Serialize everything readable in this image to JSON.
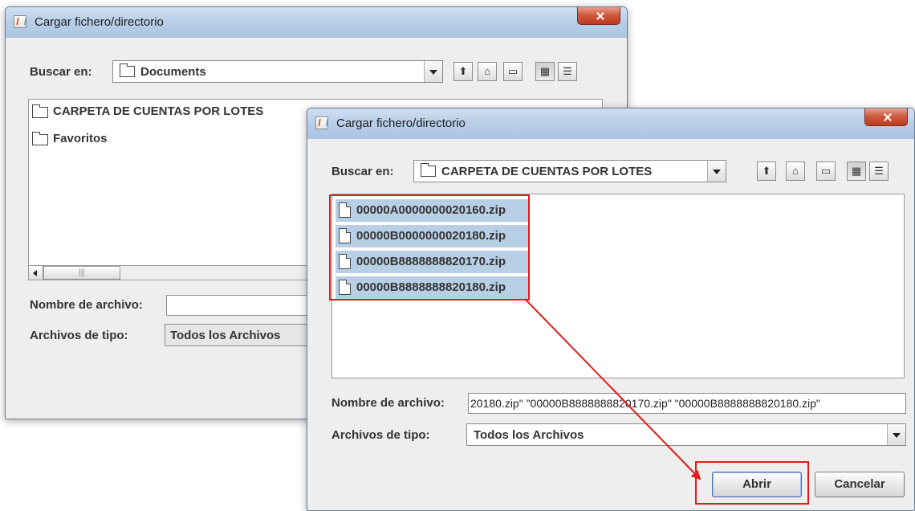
{
  "back_dialog": {
    "title": "Cargar fichero/directorio",
    "look_in_label": "Buscar en:",
    "look_in_value": "Documents",
    "folders": [
      "CARPETA DE CUENTAS POR LOTES",
      "Favoritos"
    ],
    "filename_label": "Nombre de archivo:",
    "filename_value": "",
    "filetype_label": "Archivos de tipo:",
    "filetype_value": "Todos los Archivos"
  },
  "front_dialog": {
    "title": "Cargar fichero/directorio",
    "look_in_label": "Buscar en:",
    "look_in_value": "CARPETA DE CUENTAS POR LOTES",
    "files": [
      "00000A0000000020160.zip",
      "00000B0000000020180.zip",
      "00000B8888888820170.zip",
      "00000B8888888820180.zip"
    ],
    "filename_label": "Nombre de archivo:",
    "filename_value": "20180.zip\" \"00000B8888888820170.zip\" \"00000B8888888820180.zip\"",
    "filetype_label": "Archivos de tipo:",
    "filetype_value": "Todos los Archivos",
    "open_button": "Abrir",
    "cancel_button": "Cancelar"
  },
  "toolbar_icons": [
    "up-folder-icon",
    "home-icon",
    "new-folder-icon",
    "list-view-icon",
    "details-view-icon"
  ],
  "colors": {
    "selection": "#b8cfe5",
    "highlight": "#e31b1b",
    "titlebar": "#b9cfe8"
  }
}
